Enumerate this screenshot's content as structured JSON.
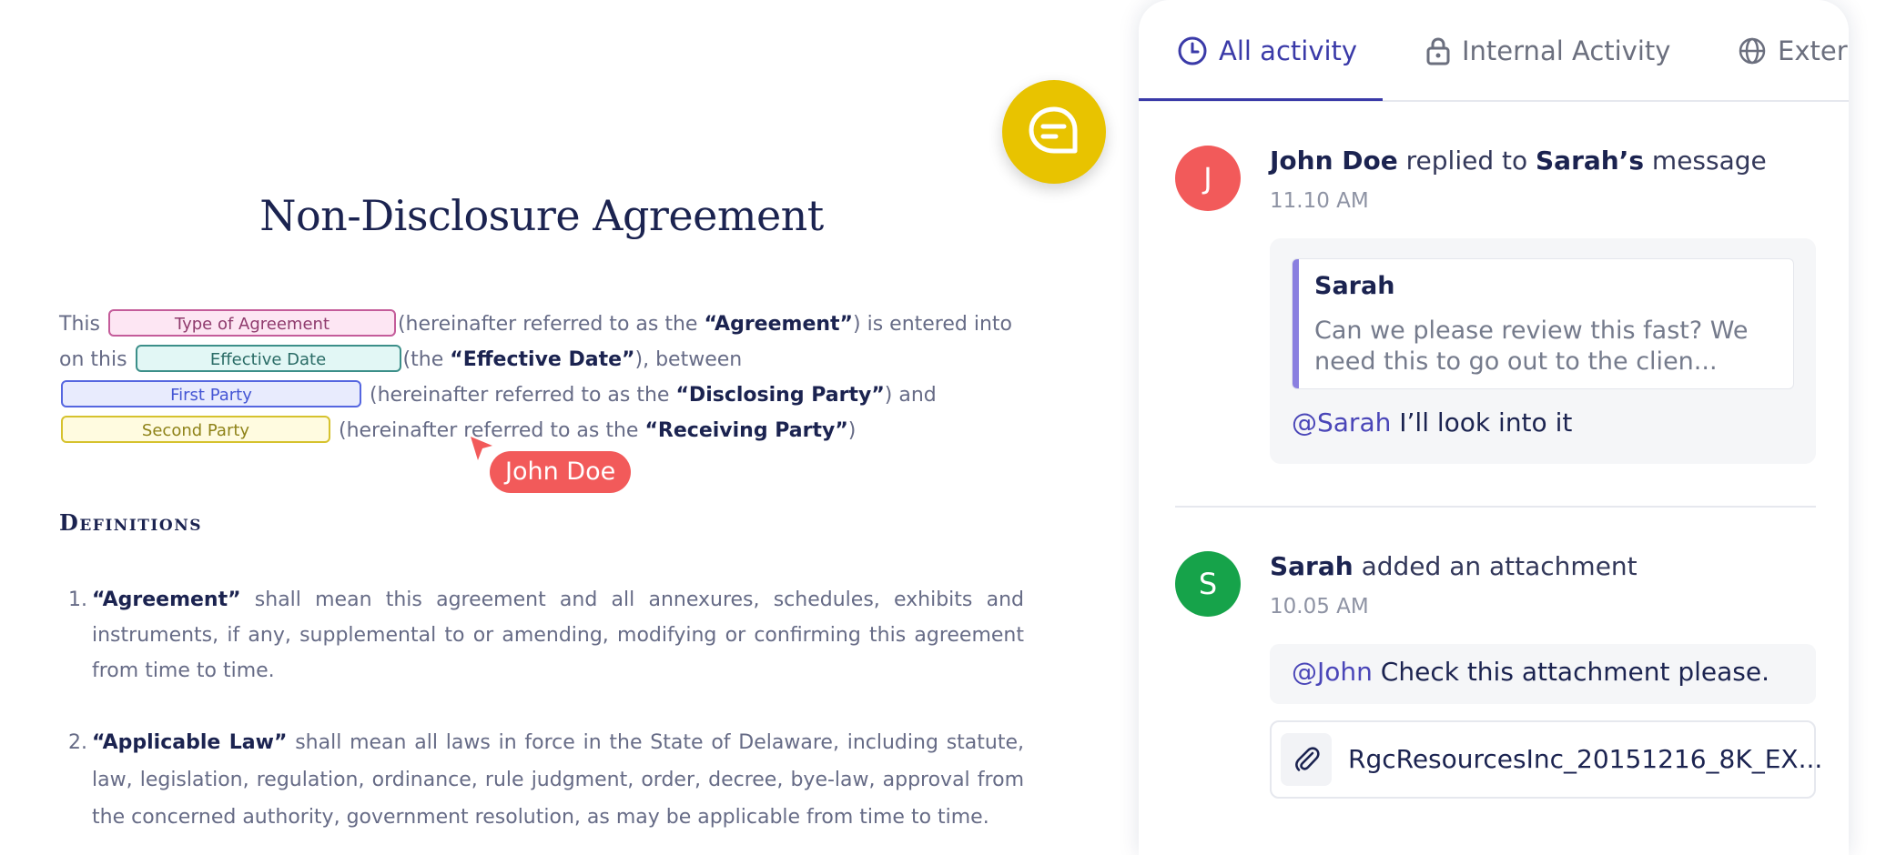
{
  "document": {
    "title": "Non-Disclosure Agreement",
    "paragraph": {
      "t1": "This",
      "placeholder_type": "Type of Agreement",
      "t2": "(hereinafter referred to as the ",
      "agreement_term": "“Agreement”",
      "t3": ") is entered into on this",
      "placeholder_date": "Effective Date",
      "t4": "(the ",
      "effective_term": "“Effective Date”",
      "t5": "), between",
      "placeholder_first": "First Party",
      "t6": "(hereinafter referred to as the ",
      "disclosing_term": "“Disclosing Party”",
      "t7": ") and",
      "placeholder_second": "Second Party",
      "t8": "(hereinafter referred to as the ",
      "receiving_term": "“Receiving Party”",
      "t9": ")"
    },
    "cursor_user": "John Doe",
    "definitions_heading": "Definitions",
    "definitions": [
      {
        "num": "1.",
        "term": "“Agreement”",
        "text": " shall mean this agreement and all annexures, schedules, exhibits and instruments, if any, supplemental to or amending, modifying or confirming this agreement from time to time."
      },
      {
        "num": "2.",
        "term": "“Applicable Law”",
        "text": " shall mean all laws in force in the State of Delaware, including statute, law, legislation, regulation, ordinance, rule judgment, order, decree, bye-law, approval from the concerned authority, government resolution, as may be applicable from time to time."
      }
    ]
  },
  "panel": {
    "tabs": {
      "all": "All activity",
      "internal": "Internal Activity",
      "external": "External Activity"
    },
    "activity1": {
      "avatar": "J",
      "user": "John Doe",
      "action": " replied to ",
      "target": "Sarah’s",
      "tail": " message",
      "time": "11.10 AM",
      "quote_name": "Sarah",
      "quote_text": "Can we please review this fast? We need this to go out to the clien...",
      "mention": "@Sarah",
      "reply": " I’ll look into it"
    },
    "activity2": {
      "avatar": "S",
      "user": "Sarah",
      "action": " added an attachment",
      "time": "10.05 AM",
      "mention": "@John",
      "message": " Check this attachment please.",
      "file": "RgcResourcesInc_20151216_8K_EX..."
    }
  },
  "colors": {
    "accent": "#3a3aa8",
    "fab": "#e8c300",
    "john": "#f25a5a",
    "sarah": "#16a34a"
  },
  "icons": {
    "fab": "chat-bubble-icon",
    "tab_all": "clock-icon",
    "tab_internal": "lock-icon",
    "tab_external": "globe-icon",
    "attachment": "paperclip-icon"
  }
}
